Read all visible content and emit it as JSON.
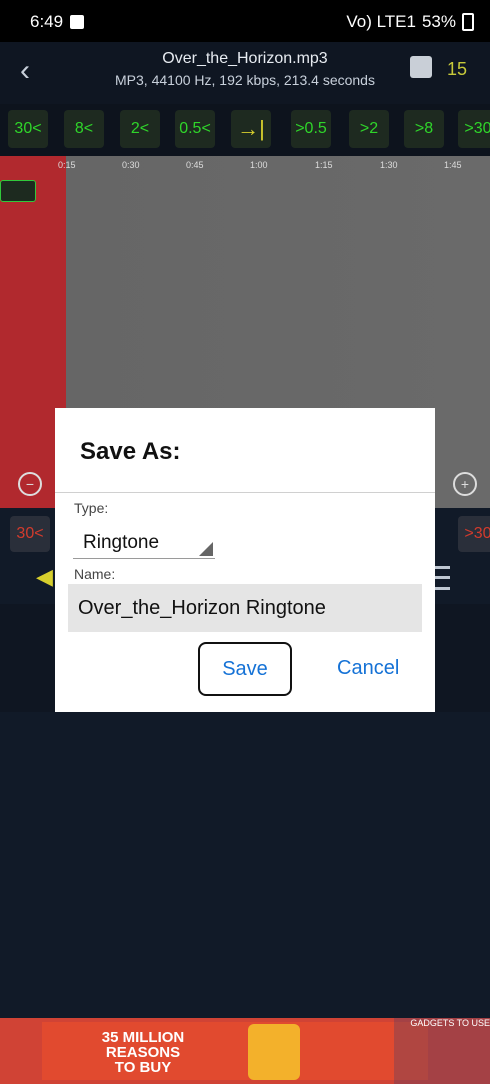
{
  "status": {
    "time": "6:49",
    "network": "Vo) LTE1",
    "battery": "53%"
  },
  "header": {
    "file_title": "Over_the_Horizon.mp3",
    "file_info": "MP3, 44100 Hz, 192 kbps, 213.4 seconds",
    "count": "15"
  },
  "seek_buttons": [
    "30<",
    "8<",
    "2<",
    "0.5<",
    "→|",
    ">0.5",
    ">2",
    ">8",
    ">30"
  ],
  "timeline": [
    "0:15",
    "0:30",
    "0:45",
    "1:00",
    "1:15",
    "1:30",
    "1:45"
  ],
  "dialog": {
    "title": "Save As:",
    "type_label": "Type:",
    "type_value": "Ringtone",
    "name_label": "Name:",
    "name_value": "Over_the_Horizon Ringtone",
    "save_label": "Save",
    "cancel_label": "Cancel"
  },
  "ad": {
    "headline": "35 MILLION REASONS TO BUY",
    "watermark": "GADGETS TO USE"
  }
}
